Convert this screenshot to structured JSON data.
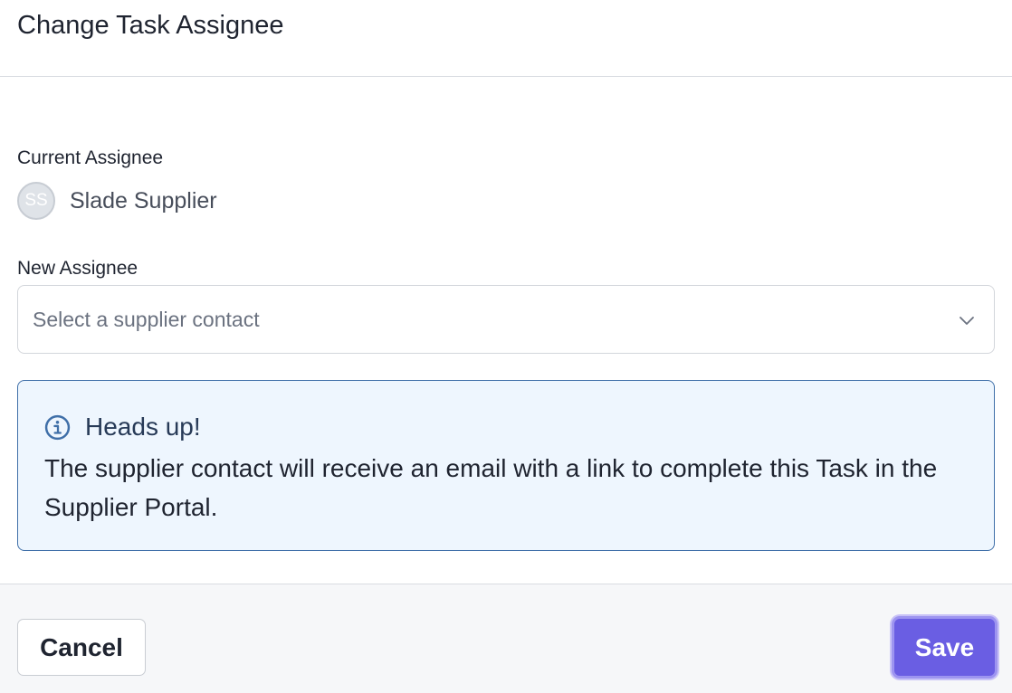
{
  "dialog": {
    "title": "Change Task Assignee"
  },
  "current_assignee": {
    "label": "Current Assignee",
    "initials": "SS",
    "name": "Slade Supplier"
  },
  "new_assignee": {
    "label": "New Assignee",
    "placeholder": "Select a supplier contact",
    "icon": "chevron-down-icon"
  },
  "alert": {
    "icon": "info-icon",
    "title": "Heads up!",
    "body": "The supplier contact will receive an email with a link to complete this Task in the Supplier Portal."
  },
  "footer": {
    "cancel_label": "Cancel",
    "save_label": "Save"
  },
  "colors": {
    "accent": "#6a5ee3",
    "alert_bg": "#eef6fe",
    "alert_border": "#3f6fa8"
  }
}
